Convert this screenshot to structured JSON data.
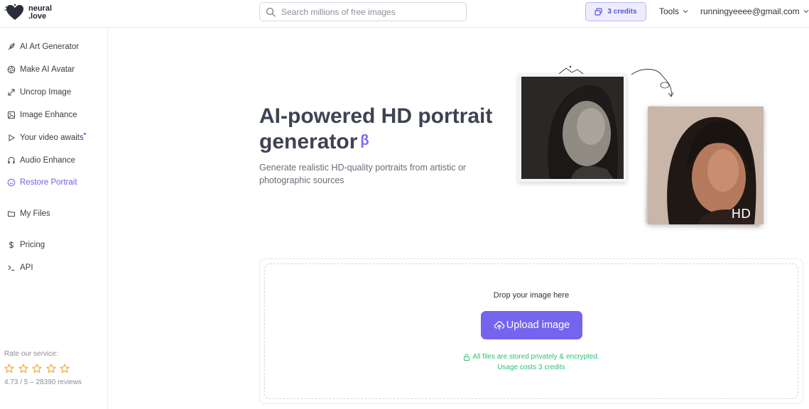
{
  "header": {
    "logo_line1": "neural",
    "logo_line2": ".love",
    "search_placeholder": "Search millions of free images",
    "credits": "3 credits",
    "tools": "Tools",
    "account": "runningyeeee@gmail.com"
  },
  "sidebar": {
    "items": [
      {
        "label": "AI Art Generator",
        "icon": "feather-icon"
      },
      {
        "label": "Make AI Avatar",
        "icon": "aperture-icon"
      },
      {
        "label": "Uncrop Image",
        "icon": "expand-icon"
      },
      {
        "label": "Image Enhance",
        "icon": "image-icon"
      },
      {
        "label": "Your video awaits",
        "icon": "play-icon"
      },
      {
        "label": "Audio Enhance",
        "icon": "headphones-icon"
      },
      {
        "label": "Restore Portrait",
        "icon": "smile-icon",
        "active": true
      },
      {
        "label": "My Files",
        "icon": "folder-icon"
      },
      {
        "label": "Pricing",
        "icon": "dollar-icon"
      },
      {
        "label": "API",
        "icon": "terminal-icon"
      }
    ],
    "rate_label": "Rate our service:",
    "rating": 0,
    "reviews": "4.73 / 5 – 28390 reviews"
  },
  "hero": {
    "title_line1": "AI-powered HD portrait",
    "title_line2": "generator",
    "beta": "β",
    "subtitle": "Generate realistic HD-quality portraits from artistic or photographic sources",
    "hd_label": "HD"
  },
  "upload": {
    "drop_text": "Drop your image here",
    "button": "Upload image",
    "secure_text": "All files are stored privately & encrypted.",
    "cost_text": "Usage costs 3 credits"
  },
  "colors": {
    "accent": "#7565ee",
    "success": "#2fbf71"
  }
}
